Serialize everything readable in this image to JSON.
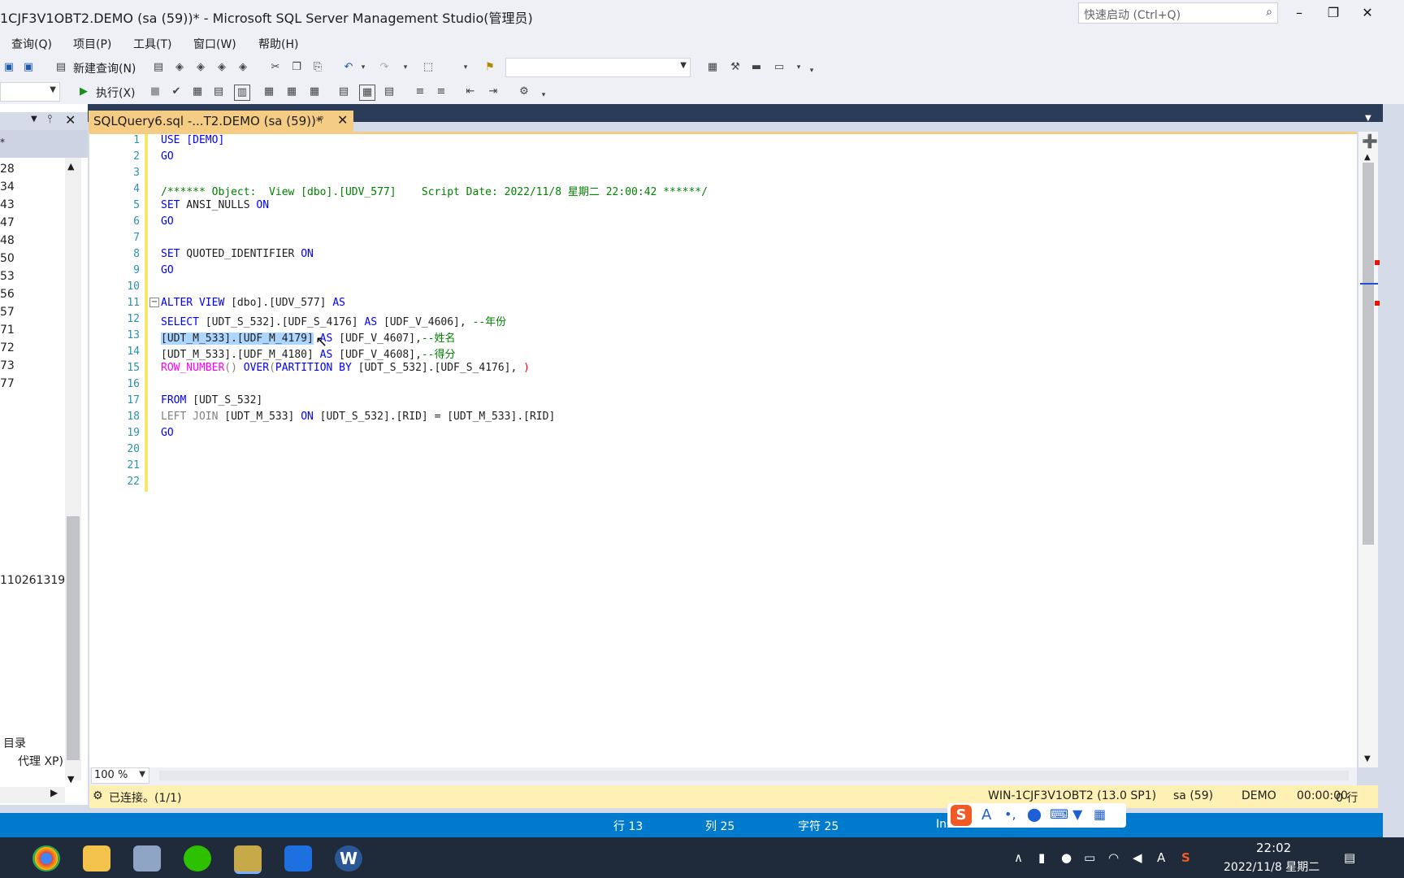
{
  "window": {
    "title": "1CJF3V1OBT2.DEMO (sa (59))* - Microsoft SQL Server Management Studio(管理员)",
    "quick_launch_placeholder": "快速启动 (Ctrl+Q)"
  },
  "menu": [
    "查询(Q)",
    "项目(P)",
    "工具(T)",
    "窗口(W)",
    "帮助(H)"
  ],
  "toolbar": {
    "new_query": "新建查询(N)",
    "execute": "执行(X)"
  },
  "left_panel": {
    "items": [
      "28",
      "34",
      "43",
      "47",
      "48",
      "50",
      "53",
      "56",
      "57",
      "71",
      "72",
      "73",
      "77"
    ],
    "bottom_item": "110261319",
    "catalog": "目录",
    "agent": "代理 XP)"
  },
  "tab": {
    "label": "SQLQuery6.sql -...T2.DEMO (sa (59))*"
  },
  "editor": {
    "line_numbers": [
      "1",
      "2",
      "3",
      "4",
      "5",
      "6",
      "7",
      "8",
      "9",
      "10",
      "11",
      "12",
      "13",
      "14",
      "15",
      "16",
      "17",
      "18",
      "19",
      "20",
      "21",
      "22"
    ],
    "lines": {
      "l1": "USE [DEMO]",
      "l2": "GO",
      "l4": "/****** Object:  View [dbo].[UDV_577]    Script Date: 2022/11/8 星期二 22:00:42 ******/",
      "l5a": "SET",
      "l5b": " ANSI_NULLS ",
      "l5c": "ON",
      "l6": "GO",
      "l8a": "SET",
      "l8b": " QUOTED_IDENTIFIER ",
      "l8c": "ON",
      "l9": "GO",
      "l11a": "ALTER VIEW",
      "l11b": " [dbo].[UDV_577] ",
      "l11c": "AS",
      "l12a": "SELECT",
      "l12b": " [UDT_S_532].[UDF_S_4176] ",
      "l12c": "AS",
      "l12d": " [UDF_V_4606], ",
      "l12e": "--年份",
      "l13a": "[UDT_M_533].[UDF_M_4179]",
      "l13b": " AS",
      "l13c": " [UDF_V_4607],",
      "l13d": "--姓名",
      "l14a": "[UDT_M_533].[UDF_M_4180] ",
      "l14b": "AS",
      "l14c": " [UDF_V_4608],",
      "l14d": "--得分",
      "l15a": "ROW_NUMBER",
      "l15b": "() ",
      "l15c": "OVER",
      "l15d": "(",
      "l15e": "PARTITION BY",
      "l15f": " [UDT_S_532].[UDF_S_4176], ",
      "l15g": ")",
      "l17a": "FROM",
      "l17b": " [UDT_S_532]",
      "l18a": "LEFT JOIN",
      "l18b": " [UDT_M_533] ",
      "l18c": "ON",
      "l18d": " [UDT_S_532].[RID] = [UDT_M_533].[RID]",
      "l19": "GO"
    }
  },
  "zoom": "100 %",
  "status": {
    "connected": "已连接。(1/1)",
    "server": "WIN-1CJF3V1OBT2 (13.0 SP1)",
    "user": "sa (59)",
    "db": "DEMO",
    "time": "00:00:00",
    "rows": "0 行"
  },
  "app_status": {
    "line": "行 13",
    "col": "列 25",
    "char": "字符 25",
    "ins": "Ins"
  },
  "taskbar": {
    "clock": "22:02",
    "date": "2022/11/8 星期二"
  },
  "colors": {
    "accent_blue": "#007acc",
    "tab_yellow": "#f5cc84",
    "status_yellow": "#fff1b3",
    "keyword": "#0000ff",
    "comment": "#008000"
  }
}
